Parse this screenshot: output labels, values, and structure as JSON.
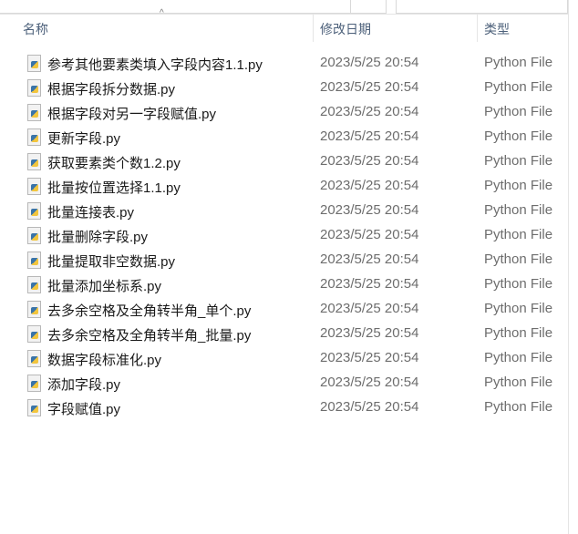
{
  "header": {
    "name": "名称",
    "date": "修改日期",
    "type": "类型"
  },
  "files": [
    {
      "name": "参考其他要素类填入字段内容1.1.py",
      "date": "2023/5/25 20:54",
      "type": "Python File"
    },
    {
      "name": "根据字段拆分数据.py",
      "date": "2023/5/25 20:54",
      "type": "Python File"
    },
    {
      "name": "根据字段对另一字段赋值.py",
      "date": "2023/5/25 20:54",
      "type": "Python File"
    },
    {
      "name": "更新字段.py",
      "date": "2023/5/25 20:54",
      "type": "Python File"
    },
    {
      "name": "获取要素类个数1.2.py",
      "date": "2023/5/25 20:54",
      "type": "Python File"
    },
    {
      "name": "批量按位置选择1.1.py",
      "date": "2023/5/25 20:54",
      "type": "Python File"
    },
    {
      "name": "批量连接表.py",
      "date": "2023/5/25 20:54",
      "type": "Python File"
    },
    {
      "name": "批量删除字段.py",
      "date": "2023/5/25 20:54",
      "type": "Python File"
    },
    {
      "name": "批量提取非空数据.py",
      "date": "2023/5/25 20:54",
      "type": "Python File"
    },
    {
      "name": "批量添加坐标系.py",
      "date": "2023/5/25 20:54",
      "type": "Python File"
    },
    {
      "name": "去多余空格及全角转半角_单个.py",
      "date": "2023/5/25 20:54",
      "type": "Python File"
    },
    {
      "name": "去多余空格及全角转半角_批量.py",
      "date": "2023/5/25 20:54",
      "type": "Python File"
    },
    {
      "name": "数据字段标准化.py",
      "date": "2023/5/25 20:54",
      "type": "Python File"
    },
    {
      "name": "添加字段.py",
      "date": "2023/5/25 20:54",
      "type": "Python File"
    },
    {
      "name": "字段赋值.py",
      "date": "2023/5/25 20:54",
      "type": "Python File"
    }
  ]
}
